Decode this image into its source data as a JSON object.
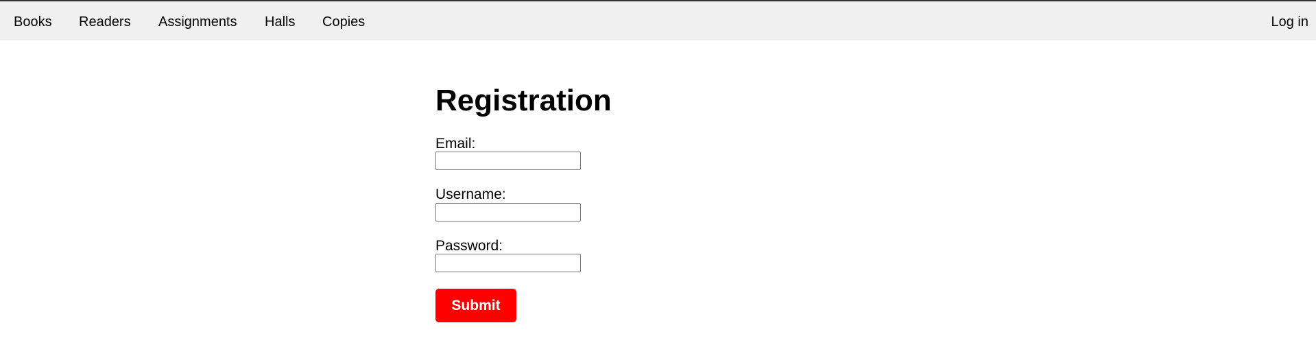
{
  "nav": {
    "items": [
      {
        "label": "Books"
      },
      {
        "label": "Readers"
      },
      {
        "label": "Assignments"
      },
      {
        "label": "Halls"
      },
      {
        "label": "Copies"
      }
    ],
    "login_label": "Log in"
  },
  "form": {
    "title": "Registration",
    "email_label": "Email:",
    "email_value": "",
    "username_label": "Username:",
    "username_value": "",
    "password_label": "Password:",
    "password_value": "",
    "submit_label": "Submit"
  },
  "colors": {
    "navbar_bg": "#f0f0f0",
    "accent": "#ff0000",
    "top_border": "#333333"
  }
}
